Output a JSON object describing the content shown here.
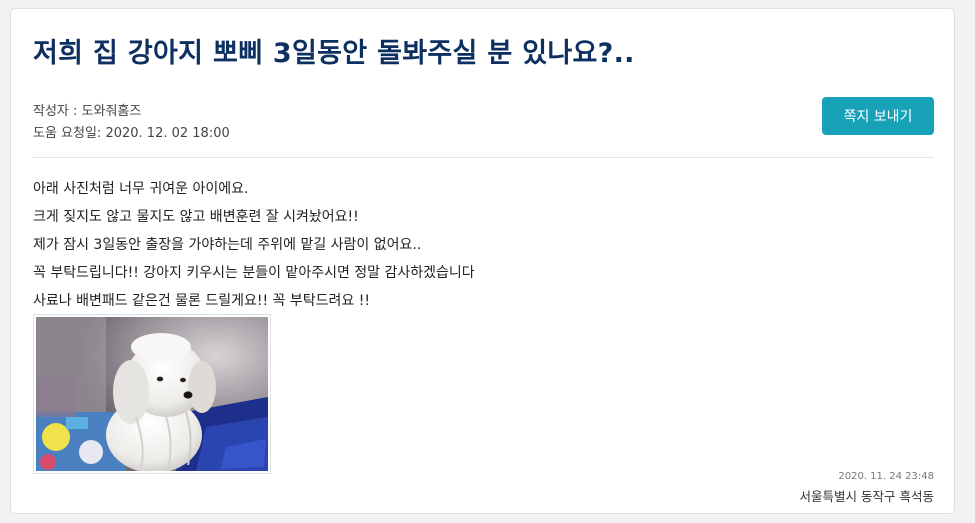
{
  "post": {
    "title": "저희 집 강아지 뽀삐 3일동안 돌봐주실 분 있나요?..",
    "author_line": "작성자 : 도와줘홈즈",
    "request_date_line": "도움 요청일: 2020. 12. 02 18:00",
    "message_button_label": "쪽지 보내기",
    "body": {
      "line1": "아래 사진처럼 너무 귀여운 아이에요.",
      "line2": "크게 짖지도 않고 물지도 않고 배변훈련 잘 시켜놨어요!!",
      "line3": "제가 잠시 3일동안 출장을 가야하는데 주위에 맡길 사람이 없어요..",
      "line4": "꼭 부탁드립니다!! 강아지 키우시는 분들이 맡아주시면 정말 감사하겠습니다",
      "line5": "사료나 배변패드 같은건 물론 드릴게요!! 꼭 부탁드려요 !!"
    },
    "image": {
      "subject": "white-maltese-puppy-photo"
    },
    "posted_at": "2020. 11. 24 23:48",
    "location": "서울특별시 동작구 흑석동"
  },
  "colors": {
    "title": "#0d3060",
    "button": "#17a2b8",
    "page_background": "#f1f2f4"
  }
}
